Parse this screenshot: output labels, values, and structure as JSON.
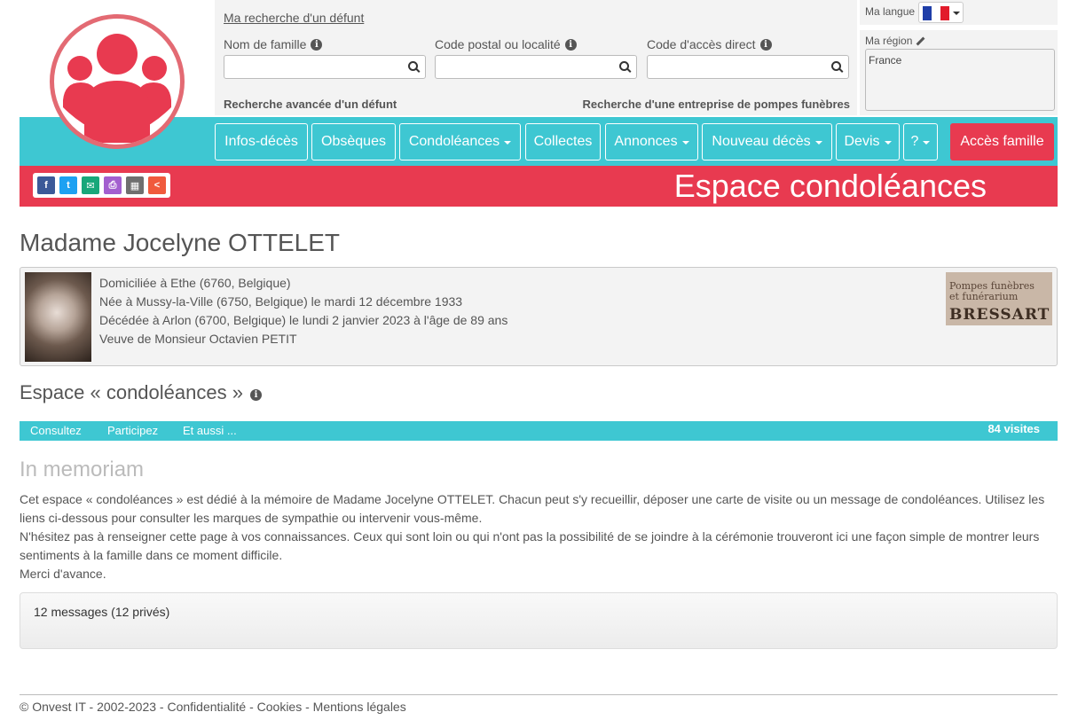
{
  "search": {
    "title_link": "Ma recherche d'un défunt",
    "fields": [
      {
        "label": "Nom de famille",
        "value": ""
      },
      {
        "label": "Code postal ou localité",
        "value": ""
      },
      {
        "label": "Code d'accès direct",
        "value": ""
      }
    ],
    "advanced_link": "Recherche avancée d'un défunt",
    "funeral_link": "Recherche d'une entreprise de pompes funèbres"
  },
  "language": {
    "label": "Ma langue",
    "flag_colors": [
      "#1f3ea8",
      "#ffffff",
      "#e21b2b"
    ]
  },
  "region": {
    "label": "Ma région",
    "value": "France"
  },
  "nav": {
    "items": [
      {
        "label": "Infos-décès",
        "dropdown": false
      },
      {
        "label": "Obsèques",
        "dropdown": false
      },
      {
        "label": "Condoléances",
        "dropdown": true
      },
      {
        "label": "Collectes",
        "dropdown": false
      },
      {
        "label": "Annonces",
        "dropdown": true
      },
      {
        "label": "Nouveau décès",
        "dropdown": true
      },
      {
        "label": "Devis",
        "dropdown": true
      },
      {
        "label": "?",
        "dropdown": true
      }
    ],
    "family_button": "Accès famille"
  },
  "share": {
    "icons": [
      {
        "name": "facebook-icon",
        "glyph": "f",
        "color": "#3b5998"
      },
      {
        "name": "twitter-icon",
        "glyph": "t",
        "color": "#1da1f2"
      },
      {
        "name": "email-icon",
        "glyph": "✉",
        "color": "#18a77a"
      },
      {
        "name": "print-icon",
        "glyph": "⎙",
        "color": "#a35fcf"
      },
      {
        "name": "qrcode-icon",
        "glyph": "▦",
        "color": "#6f6f6f"
      },
      {
        "name": "share-icon",
        "glyph": "<",
        "color": "#f05a3d"
      }
    ]
  },
  "banner": {
    "title": "Espace condoléances"
  },
  "person": {
    "name": "Madame Jocelyne OTTELET",
    "lines": [
      "Domiciliée à Ethe (6760, Belgique)",
      "Née à Mussy-la-Ville (6750, Belgique) le mardi 12 décembre 1933",
      "Décédée à Arlon (6700, Belgique) le lundi 2 janvier 2023 à l'âge de 89 ans",
      "Veuve de Monsieur Octavien PETIT"
    ],
    "funeral_logo": {
      "line1": "Pompes funèbres",
      "line2": "et funérarium",
      "brand": "BRESSART"
    }
  },
  "section": {
    "title": "Espace « condoléances »"
  },
  "tabs": {
    "items": [
      "Consultez",
      "Participez",
      "Et aussi ..."
    ],
    "visits": "84 visites"
  },
  "memoriam": {
    "title": "In memoriam",
    "paragraphs": [
      "Cet espace « condoléances » est dédié à la mémoire de Madame Jocelyne OTTELET. Chacun peut s'y recueillir, déposer une carte de visite ou un message de condoléances. Utilisez les liens ci-dessous pour consulter les marques de sympathie ou intervenir vous-même.",
      "N'hésitez pas à renseigner cette page à vos connaissances. Ceux qui sont loin ou qui n'ont pas la possibilité de se joindre à la cérémonie trouveront ici une façon simple de montrer leurs sentiments à la famille dans ce moment difficile.",
      "Merci d'avance."
    ]
  },
  "messages": {
    "summary": "12 messages (12 privés)"
  },
  "footer": {
    "text": "© Onvest IT - 2002-2023 - Confidentialité - Cookies - Mentions légales"
  },
  "colors": {
    "teal": "#3ec7d2",
    "red": "#e83a50",
    "logo_pink": "#e36a73"
  }
}
